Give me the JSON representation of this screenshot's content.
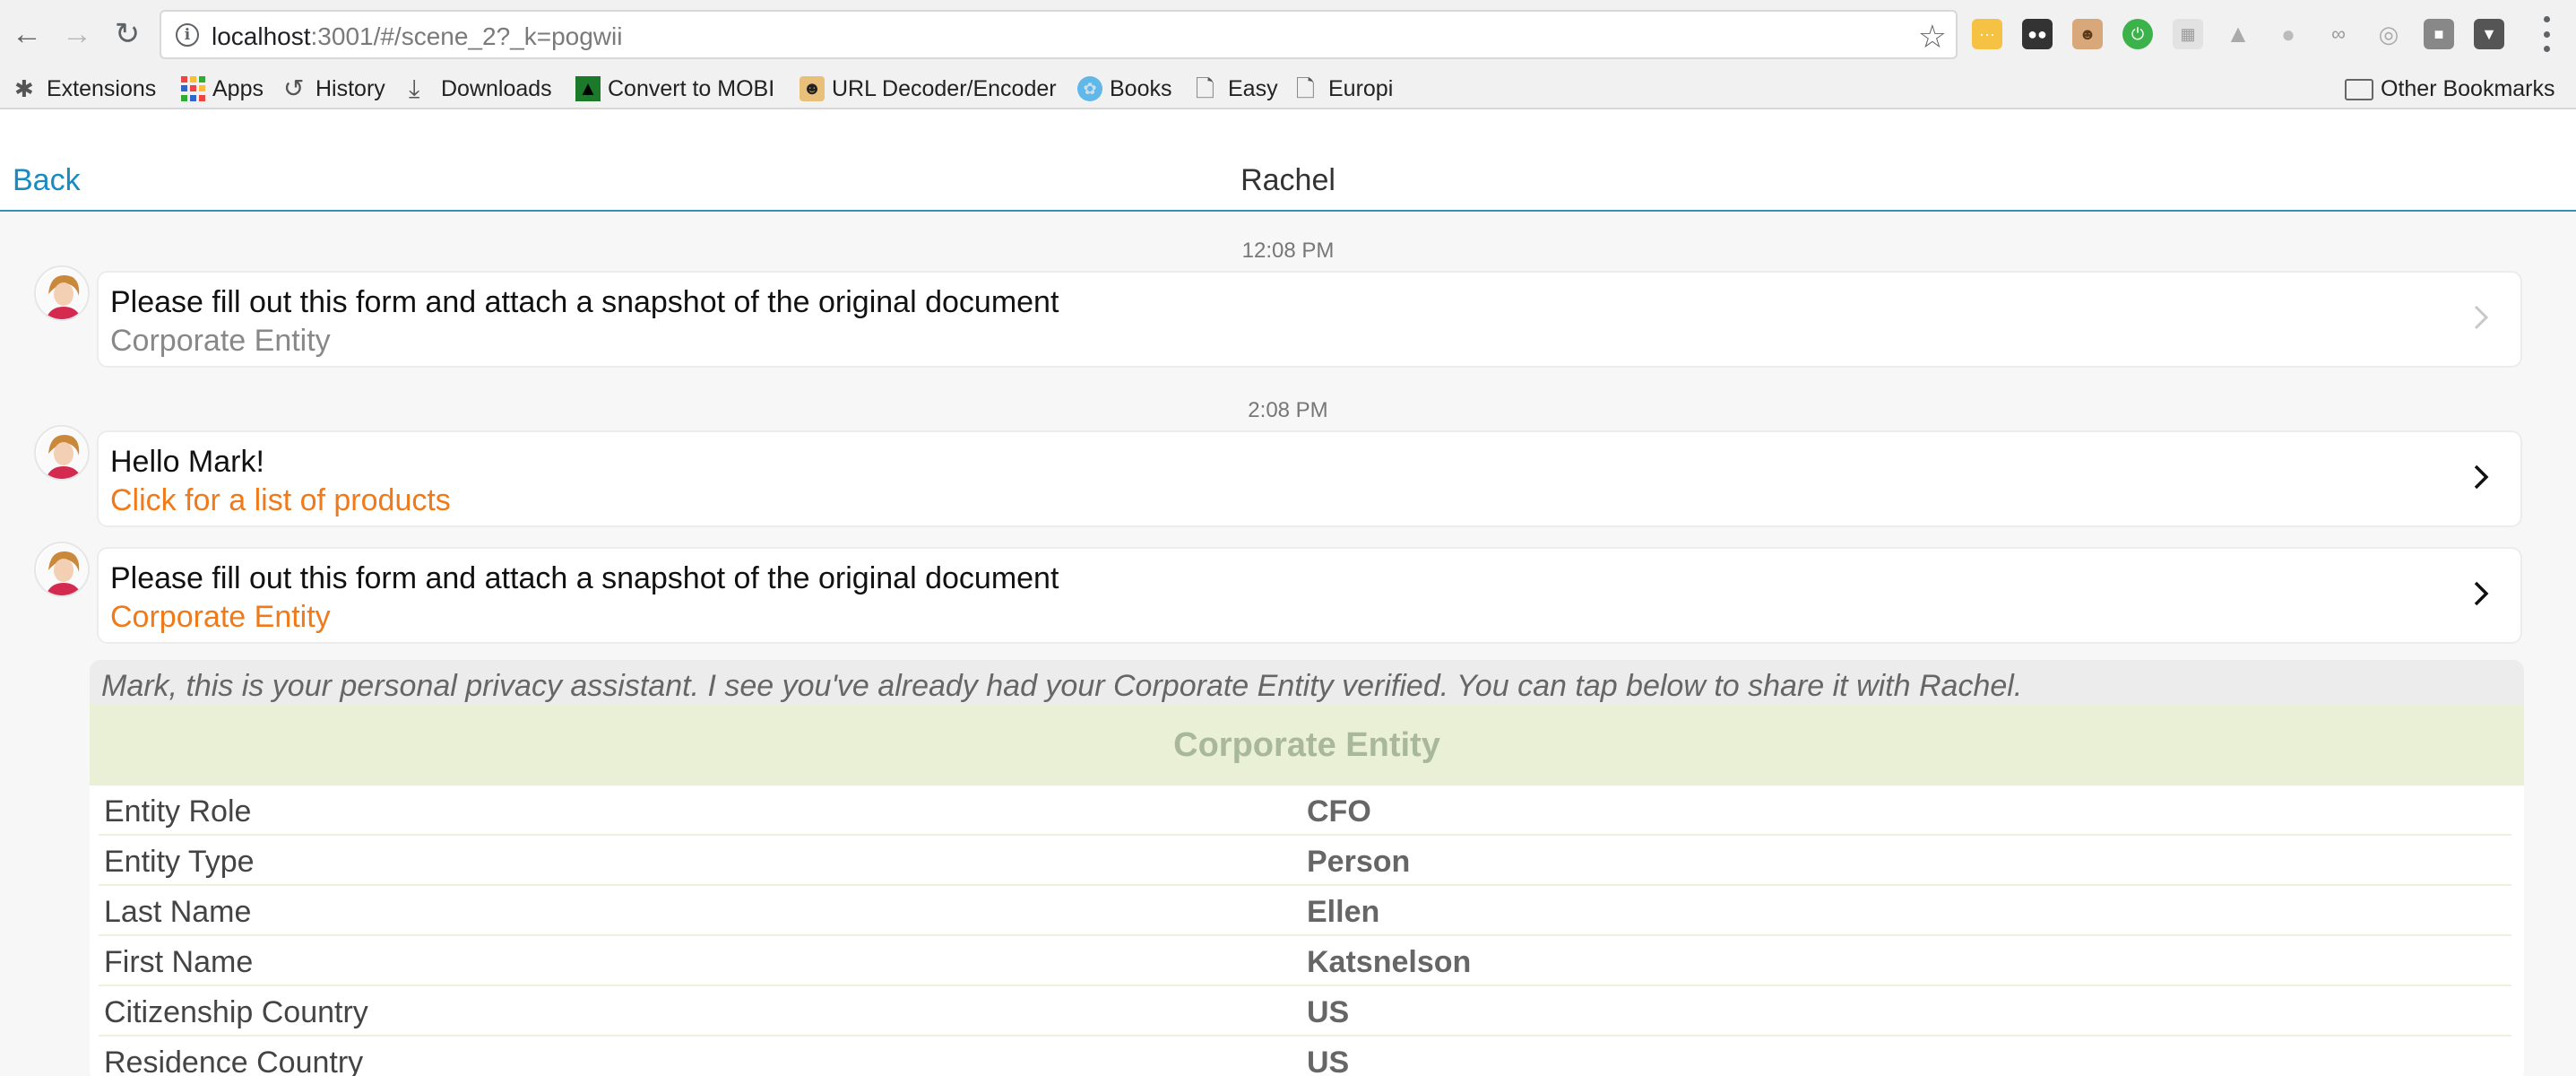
{
  "browser": {
    "url_host": "localhost",
    "url_rest": ":3001/#/scene_2?_k=pogwii",
    "bookmarks": [
      {
        "label": "Extensions",
        "icon": "puzzle-icon"
      },
      {
        "label": "Apps",
        "icon": "apps-grid-icon"
      },
      {
        "label": "History",
        "icon": "history-icon"
      },
      {
        "label": "Downloads",
        "icon": "download-icon"
      },
      {
        "label": "Convert to MOBI",
        "icon": "mobi-icon"
      },
      {
        "label": "URL Decoder/Encoder",
        "icon": "url-decoder-icon"
      },
      {
        "label": "Books",
        "icon": "books-icon"
      },
      {
        "label": "Easy",
        "icon": "page-icon"
      },
      {
        "label": "Europi",
        "icon": "page-icon"
      }
    ],
    "other_bookmarks": "Other Bookmarks",
    "extension_icons": [
      "ext-yellow-icon",
      "ext-binoculars-icon",
      "ext-face-icon",
      "ext-green-power-icon",
      "ext-grid-icon",
      "ext-drive-icon",
      "ext-bulb-icon",
      "ext-glasses-icon",
      "ext-circle-icon",
      "ext-square-icon",
      "ext-pocket-icon"
    ]
  },
  "header": {
    "back_label": "Back",
    "title": "Rachel"
  },
  "messages": [
    {
      "time": "12:08 PM",
      "text": "Please fill out this form and attach a snapshot of the original document",
      "subtext": "Corporate Entity",
      "subtext_style": "grey",
      "chevron": "chevron-right-icon",
      "chevron_color": "#c8c8c8"
    },
    {
      "time": "2:08 PM",
      "text": "Hello Mark!",
      "subtext": "Click for a list of products",
      "subtext_style": "orange",
      "chevron": "chevron-right-icon",
      "chevron_color": "#111111"
    },
    {
      "time": "",
      "text": "Please fill out this form and attach a snapshot of the original document",
      "subtext": "Corporate Entity",
      "subtext_style": "orange",
      "chevron": "chevron-right-icon",
      "chevron_color": "#111111"
    }
  ],
  "assistant": {
    "note": "Mark, this is your personal privacy assistant. I see you've already had your Corporate Entity verified. You can tap below to share it with Rachel.",
    "entity_title": "Corporate Entity",
    "fields": [
      {
        "key": "Entity Role",
        "value": "CFO"
      },
      {
        "key": "Entity Type",
        "value": "Person"
      },
      {
        "key": "Last Name",
        "value": "Ellen"
      },
      {
        "key": "First Name",
        "value": "Katsnelson"
      },
      {
        "key": "Citizenship Country",
        "value": "US"
      },
      {
        "key": "Residence Country",
        "value": "US"
      }
    ]
  },
  "colors": {
    "link_blue": "#1a8ac0",
    "accent_orange": "#f07a1a",
    "entity_header_bg": "#e9f0d6"
  }
}
